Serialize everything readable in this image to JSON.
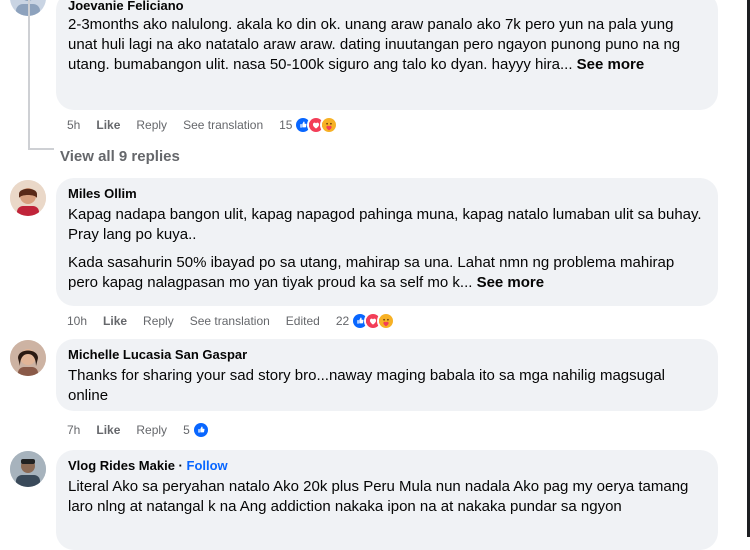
{
  "comments": [
    {
      "author": "Joevanie Feliciano",
      "text": "2-3months ako nalulong. akala ko din ok. unang araw panalo ako 7k pero yun na pala yung unat huli lagi na ako natatalo araw araw. dating inuutangan pero ngayon punong puno na ng utang. bumabangon ulit. nasa 50-100k siguro ang talo ko dyan. hayyy hira...",
      "see_more": "See more",
      "time": "5h",
      "like": "Like",
      "reply": "Reply",
      "translate": "See translation",
      "reaction_count": "15"
    },
    {
      "author": "Miles Ollim",
      "text1": "Kapag nadapa bangon ulit, kapag napagod pahinga muna, kapag natalo lumaban ulit sa buhay. Pray lang po kuya..",
      "text2": "Kada sasahurin 50% ibayad po sa utang, mahirap sa una. Lahat nmn ng problema mahirap pero kapag nalagpasan mo yan tiyak proud ka sa self mo k...",
      "see_more": "See more",
      "time": "10h",
      "like": "Like",
      "reply": "Reply",
      "translate": "See translation",
      "edited": "Edited",
      "reaction_count": "22"
    },
    {
      "author": "Michelle Lucasia San Gaspar",
      "text": "Thanks for sharing your sad story bro...naway maging babala ito sa mga nahilig magsugal online",
      "time": "7h",
      "like": "Like",
      "reply": "Reply",
      "reaction_count": "5"
    },
    {
      "author": "Vlog Rides Makie",
      "follow": "Follow",
      "separator": "·",
      "text": "Literal Ako sa peryahan natalo Ako 20k plus Peru Mula nun nadala Ako pag my oerya tamang laro nlng at natangal k na Ang addiction nakaka ipon na at nakaka pundar sa ngyon"
    }
  ],
  "view_replies": "View all 9 replies",
  "colors": {
    "bubble": "#f0f2f5",
    "meta": "#65676b",
    "like_blue": "#0866ff",
    "love_red": "#f33e58",
    "care_yellow": "#f7b125"
  },
  "icons": [
    "like-reaction-icon",
    "love-reaction-icon",
    "care-reaction-icon"
  ]
}
